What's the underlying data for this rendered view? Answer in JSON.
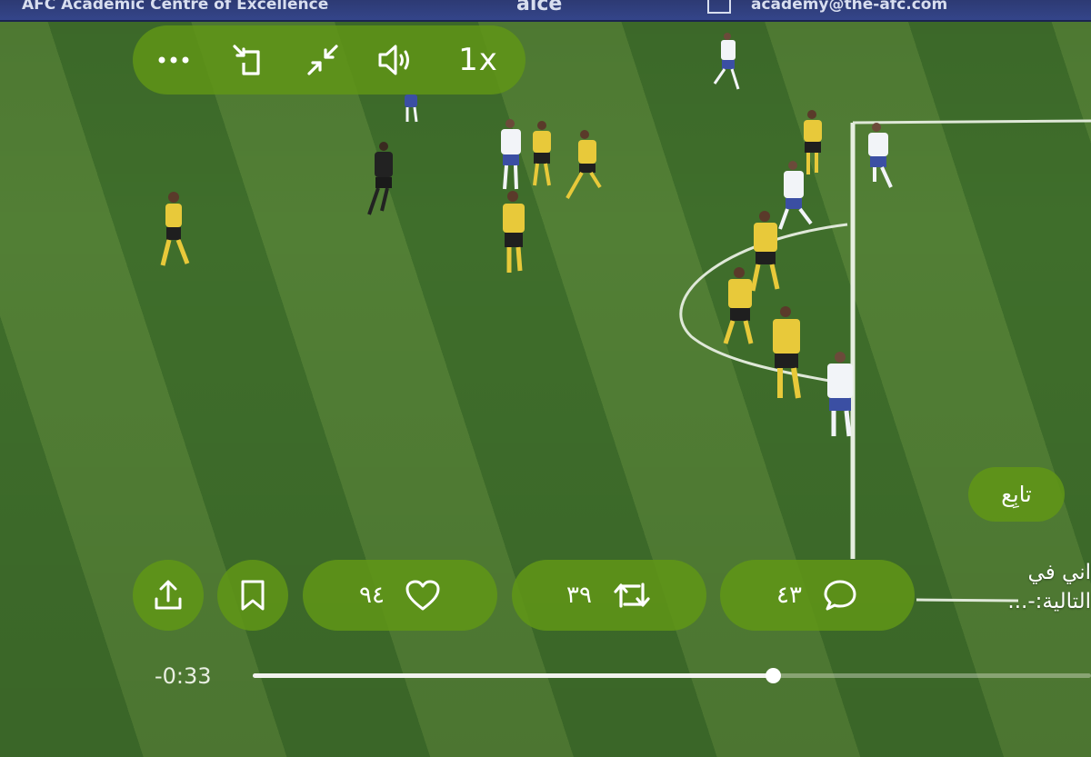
{
  "video": {
    "ad_board": {
      "left_text": "AFC Academic Centre of Excellence",
      "center_text": "aice",
      "right_text": "academy@the-afc.com"
    }
  },
  "controls": {
    "more_icon": "more-horizontal-icon",
    "rotate_icon": "rotate-screen-icon",
    "minimize_icon": "minimize-icon",
    "volume_icon": "volume-icon",
    "speed_label": "1x"
  },
  "follow_button": {
    "label": "تابِع"
  },
  "caption": {
    "line1": "اني في",
    "line2": "التالية:-..."
  },
  "actions": {
    "share_icon": "share-icon",
    "bookmark_icon": "bookmark-icon",
    "likes": {
      "icon": "heart-icon",
      "count": "٩٤"
    },
    "reposts": {
      "icon": "repost-icon",
      "count": "٣٩"
    },
    "replies": {
      "icon": "comment-icon",
      "count": "٤٣"
    }
  },
  "player": {
    "time_remaining": "-0:33",
    "progress_fraction": 0.62
  },
  "colors": {
    "control_bg": "#609616",
    "home_kit": "#e8c93a",
    "away_kit": "#f2f4f8"
  }
}
